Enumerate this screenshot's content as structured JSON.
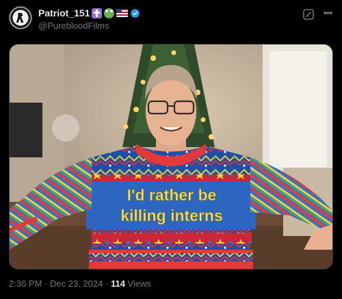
{
  "post": {
    "display_name": "Patriot_151",
    "handle": "@PurebloodFilms",
    "name_emojis": [
      "cross-icon",
      "frog-icon",
      "us-flag-icon"
    ],
    "verified": true,
    "time": "2:36 PM",
    "separator": "·",
    "date": "Dec 23, 2024",
    "views_count": "114",
    "views_label": "Views"
  },
  "image": {
    "sweater_text_line1": "I'd rather be",
    "sweater_text_line2": "killing interns"
  },
  "colors": {
    "background": "#000000",
    "text_primary": "#e7e9ea",
    "text_secondary": "#71767b",
    "verified_blue": "#1d9bf0"
  }
}
